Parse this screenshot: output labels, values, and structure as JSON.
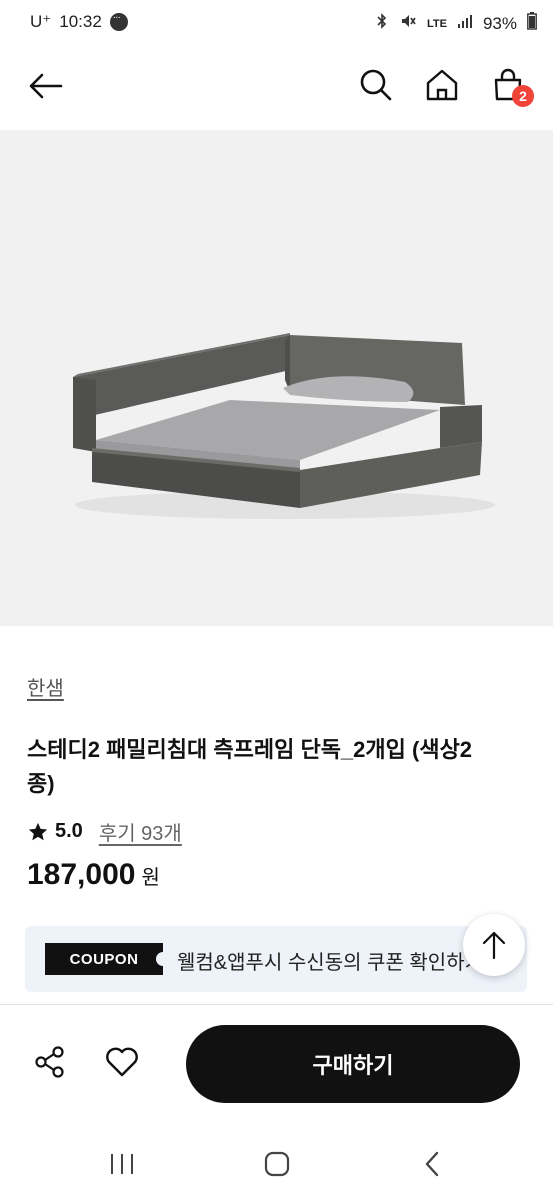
{
  "status_bar": {
    "carrier": "U⁺",
    "time": "10:32",
    "network": "LTE",
    "battery": "93%"
  },
  "header": {
    "cart_count": "2"
  },
  "product": {
    "brand": "한샘",
    "title": "스테디2 패밀리침대 측프레임 단독_2개입 (색상2종)",
    "rating": "5.0",
    "reviews": "후기 93개",
    "price": "187,000",
    "currency": "원"
  },
  "coupon": {
    "tag": "COUPON",
    "text": "웰컴&앱푸시 수신동의 쿠폰 확인하기"
  },
  "bottom_bar": {
    "buy_label": "구매하기"
  },
  "colors": {
    "accent": "#111111",
    "badge": "#f04438",
    "coupon_bg": "#eef3fa"
  }
}
